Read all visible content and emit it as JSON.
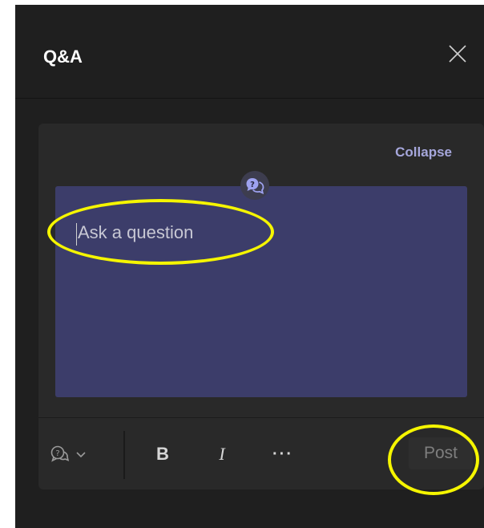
{
  "header": {
    "title": "Q&A"
  },
  "composer": {
    "collapse_label": "Collapse",
    "input_placeholder": "Ask a question",
    "input_value": "",
    "post_label": "Post",
    "bold_label": "B",
    "italic_label": "I",
    "more_label": "···"
  },
  "icons": {
    "close": "close-icon",
    "qa_avatar": "question-bubble-icon",
    "type_selector": "question-bubble-icon",
    "chevron": "chevron-down-icon"
  },
  "colors": {
    "panel_bg": "#1f1f1f",
    "card_bg": "#292929",
    "editor_bg": "#3c3d6a",
    "accent": "#a6a7dc",
    "highlight": "#f5f500"
  }
}
